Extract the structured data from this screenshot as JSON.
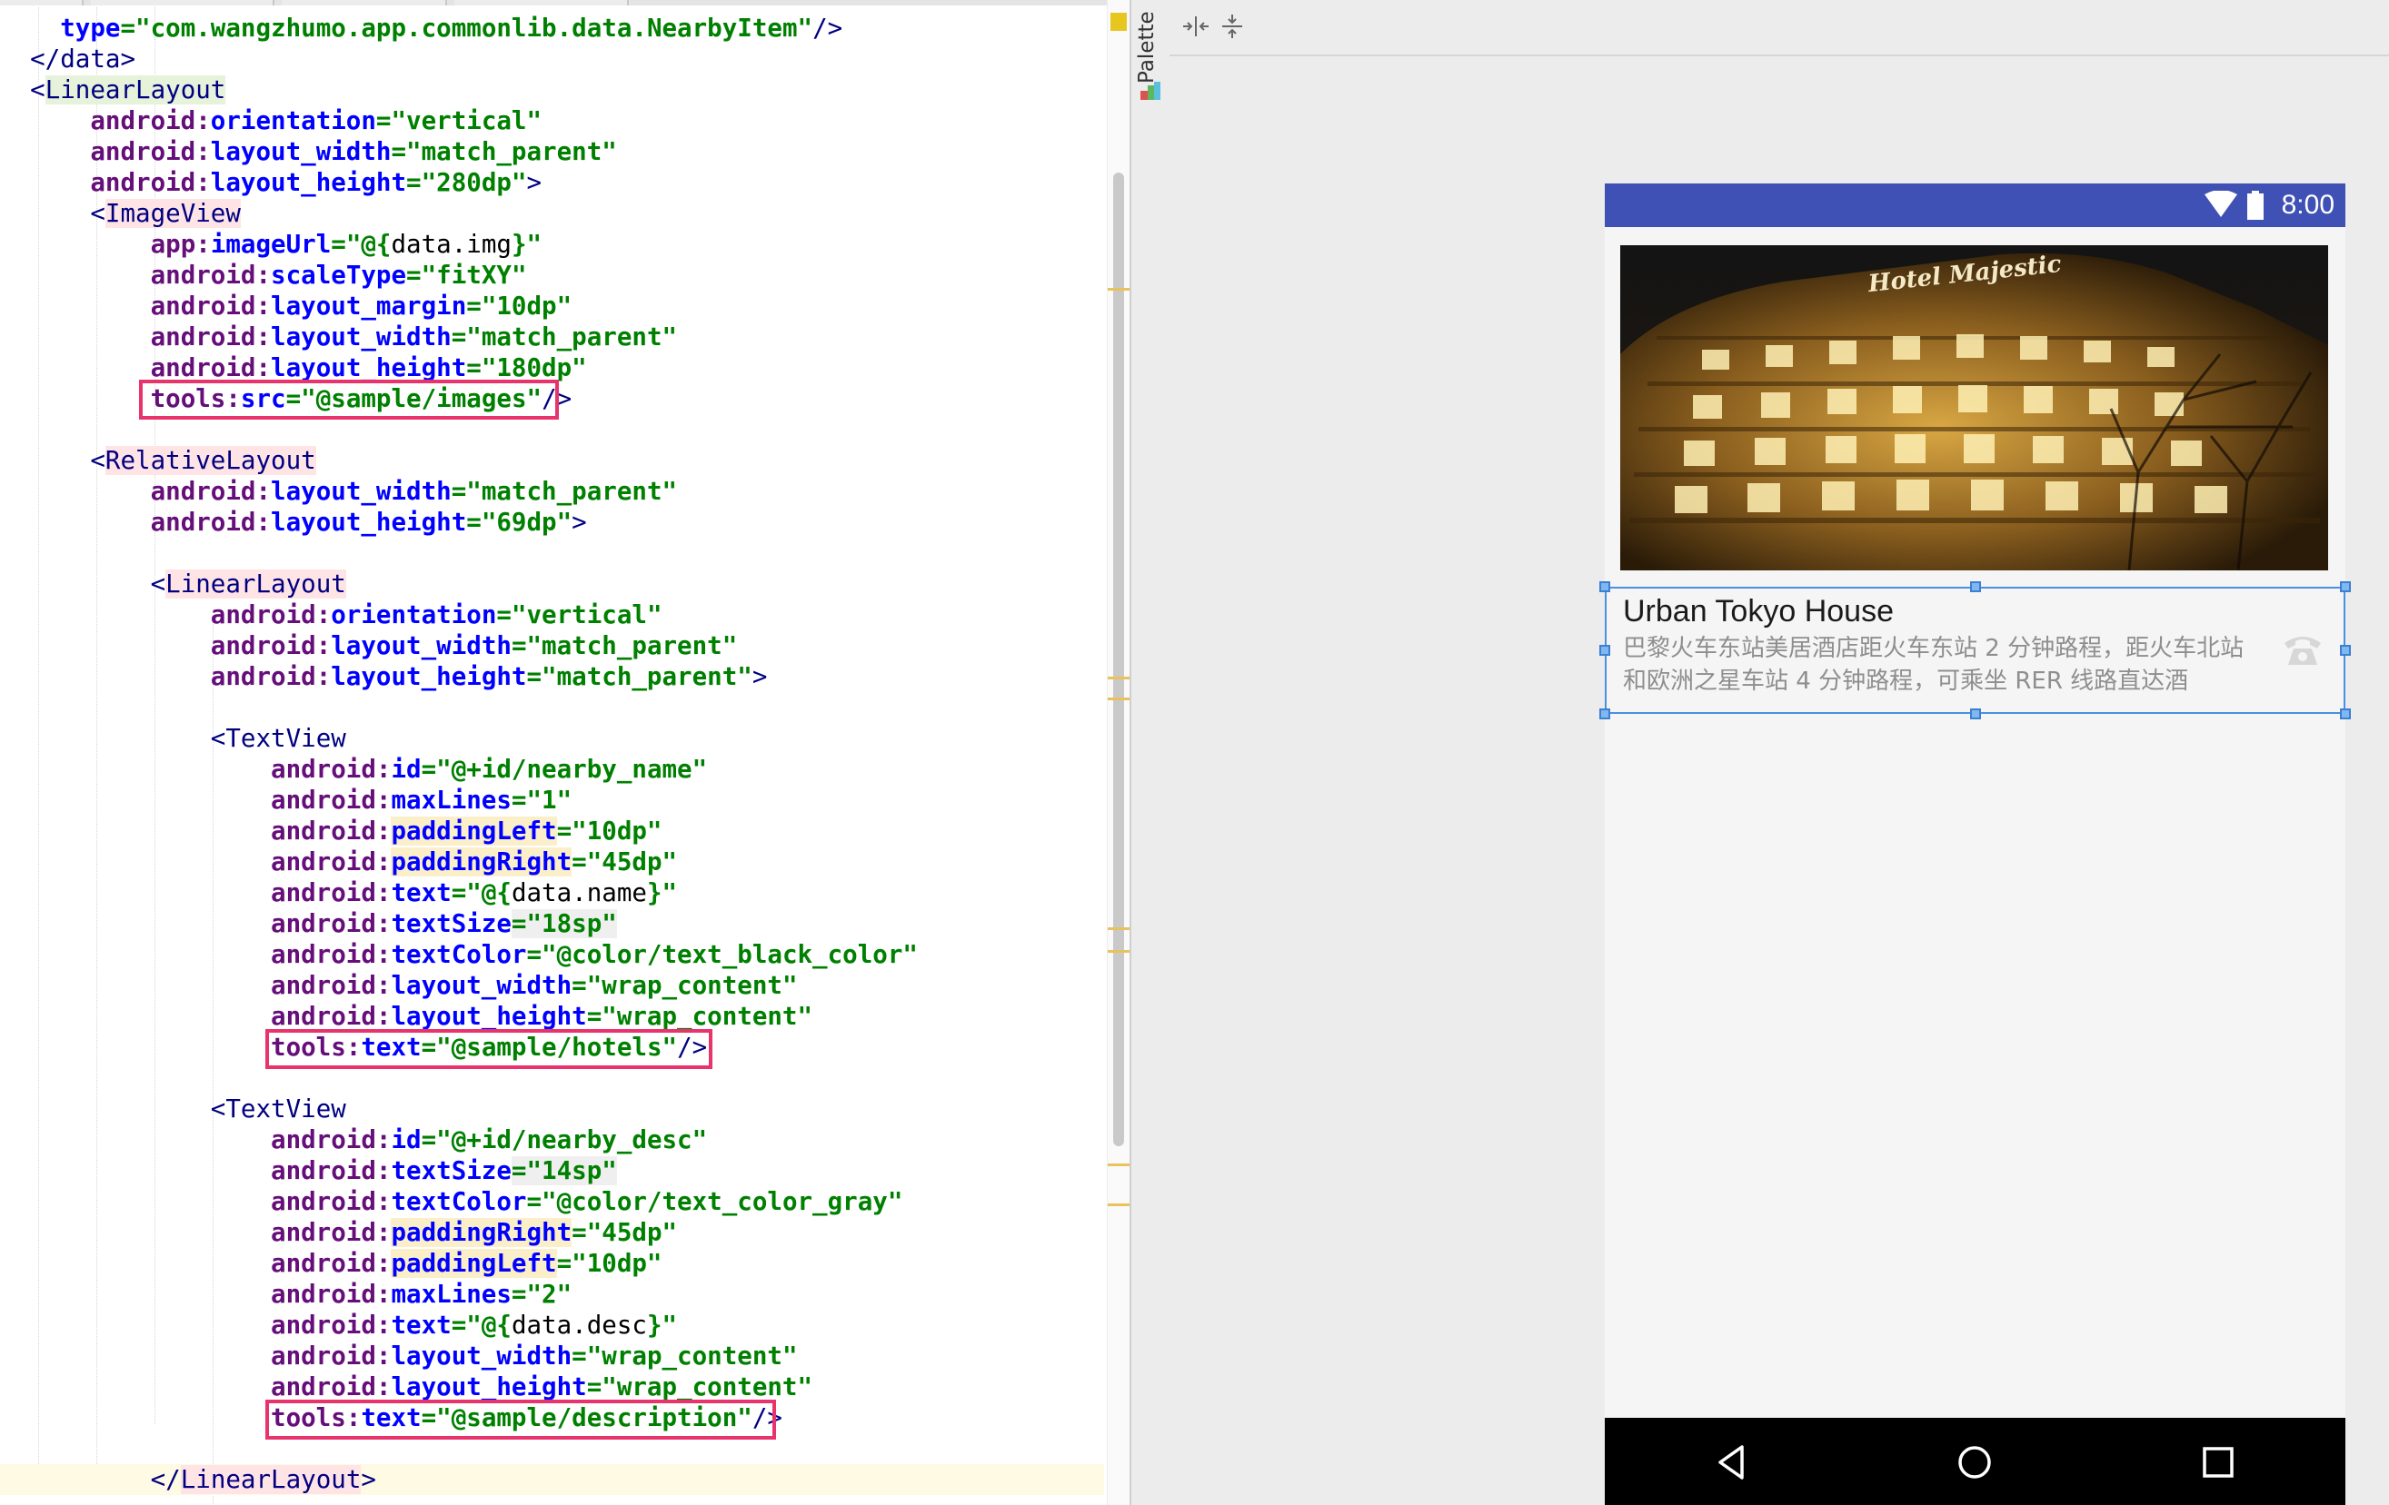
{
  "editor": {
    "lines": [
      [
        [
          "",
          "    "
        ],
        [
          "attr",
          "type"
        ],
        [
          "val",
          "=\"com.wangzhumo.app.commonlib.data.NearbyItem\""
        ],
        [
          "tag",
          "/>"
        ]
      ],
      [
        [
          "",
          "  "
        ],
        [
          "tag",
          "</data>"
        ]
      ],
      [
        [
          "",
          "  "
        ],
        [
          "tag",
          "<"
        ],
        [
          "tagname-sel",
          "LinearLayout"
        ]
      ],
      [
        [
          "",
          "      "
        ],
        [
          "nsp",
          "android:"
        ],
        [
          "attr",
          "orientation"
        ],
        [
          "val",
          "=\"vertical\""
        ]
      ],
      [
        [
          "",
          "      "
        ],
        [
          "nsp",
          "android:"
        ],
        [
          "attr",
          "layout_width"
        ],
        [
          "val",
          "=\"match_parent\""
        ]
      ],
      [
        [
          "",
          "      "
        ],
        [
          "nsp",
          "android:"
        ],
        [
          "attr",
          "layout_height"
        ],
        [
          "val",
          "=\"280dp\""
        ],
        [
          "tag",
          ">"
        ]
      ],
      [
        [
          "",
          "      "
        ],
        [
          "tag",
          "<"
        ],
        [
          "tagname-hl",
          "ImageView"
        ]
      ],
      [
        [
          "",
          "          "
        ],
        [
          "nsp",
          "app:"
        ],
        [
          "attr",
          "imageUrl"
        ],
        [
          "val",
          "=\"@{"
        ],
        [
          "val-plain",
          "data.img"
        ],
        [
          "val",
          "}\""
        ]
      ],
      [
        [
          "",
          "          "
        ],
        [
          "nsp",
          "android:"
        ],
        [
          "attr",
          "scaleType"
        ],
        [
          "val",
          "=\"fitXY\""
        ]
      ],
      [
        [
          "",
          "          "
        ],
        [
          "nsp",
          "android:"
        ],
        [
          "attr",
          "layout_margin"
        ],
        [
          "val",
          "=\"10dp\""
        ]
      ],
      [
        [
          "",
          "          "
        ],
        [
          "nsp",
          "android:"
        ],
        [
          "attr",
          "layout_width"
        ],
        [
          "val",
          "=\"match_parent\""
        ]
      ],
      [
        [
          "",
          "          "
        ],
        [
          "nsp",
          "android:"
        ],
        [
          "attr",
          "layout_height"
        ],
        [
          "val",
          "=\"180dp\""
        ]
      ],
      [
        [
          "",
          "          "
        ],
        [
          "nsp",
          "tools:"
        ],
        [
          "attr",
          "src"
        ],
        [
          "val",
          "=\"@sample/images\""
        ],
        [
          "tag",
          "/>"
        ]
      ],
      [
        [
          "",
          ""
        ]
      ],
      [
        [
          "",
          "      "
        ],
        [
          "tag",
          "<"
        ],
        [
          "tagname-hl",
          "RelativeLayout"
        ]
      ],
      [
        [
          "",
          "          "
        ],
        [
          "nsp",
          "android:"
        ],
        [
          "attr",
          "layout_width"
        ],
        [
          "val",
          "=\"match_parent\""
        ]
      ],
      [
        [
          "",
          "          "
        ],
        [
          "nsp",
          "android:"
        ],
        [
          "attr",
          "layout_height"
        ],
        [
          "val",
          "=\"69dp\""
        ],
        [
          "tag",
          ">"
        ]
      ],
      [
        [
          "",
          ""
        ]
      ],
      [
        [
          "",
          "          "
        ],
        [
          "tag",
          "<"
        ],
        [
          "tagname-hl",
          "LinearLayout"
        ]
      ],
      [
        [
          "",
          "              "
        ],
        [
          "nsp",
          "android:"
        ],
        [
          "attr",
          "orientation"
        ],
        [
          "val",
          "=\"vertical\""
        ]
      ],
      [
        [
          "",
          "              "
        ],
        [
          "nsp",
          "android:"
        ],
        [
          "attr",
          "layout_width"
        ],
        [
          "val",
          "=\"match_parent\""
        ]
      ],
      [
        [
          "",
          "              "
        ],
        [
          "nsp",
          "android:"
        ],
        [
          "attr",
          "layout_height"
        ],
        [
          "val",
          "=\"match_parent\""
        ],
        [
          "tag",
          ">"
        ]
      ],
      [
        [
          "",
          ""
        ]
      ],
      [
        [
          "",
          "              "
        ],
        [
          "tag",
          "<TextView"
        ]
      ],
      [
        [
          "",
          "                  "
        ],
        [
          "nsp",
          "android:"
        ],
        [
          "attr",
          "id"
        ],
        [
          "val",
          "=\"@+id/nearby_name\""
        ]
      ],
      [
        [
          "",
          "                  "
        ],
        [
          "nsp",
          "android:"
        ],
        [
          "attr",
          "maxLines"
        ],
        [
          "val",
          "=\"1\""
        ]
      ],
      [
        [
          "",
          "                  "
        ],
        [
          "nsp",
          "android:"
        ],
        [
          "attr-hl",
          "paddingLeft"
        ],
        [
          "val",
          "=\"10dp\""
        ]
      ],
      [
        [
          "",
          "                  "
        ],
        [
          "nsp",
          "android:"
        ],
        [
          "attr-hl",
          "paddingRight"
        ],
        [
          "val",
          "=\"45dp\""
        ]
      ],
      [
        [
          "",
          "                  "
        ],
        [
          "nsp",
          "android:"
        ],
        [
          "attr",
          "text"
        ],
        [
          "val",
          "=\"@{"
        ],
        [
          "val-plain",
          "data.name"
        ],
        [
          "val",
          "}\""
        ]
      ],
      [
        [
          "",
          "                  "
        ],
        [
          "nsp",
          "android:"
        ],
        [
          "attr",
          "textSize"
        ],
        [
          "val-gray",
          "=\"18sp\""
        ]
      ],
      [
        [
          "",
          "                  "
        ],
        [
          "nsp",
          "android:"
        ],
        [
          "attr",
          "textColor"
        ],
        [
          "val",
          "=\"@color/text_black_color\""
        ]
      ],
      [
        [
          "",
          "                  "
        ],
        [
          "nsp",
          "android:"
        ],
        [
          "attr",
          "layout_width"
        ],
        [
          "val",
          "=\"wrap_content\""
        ]
      ],
      [
        [
          "",
          "                  "
        ],
        [
          "nsp",
          "android:"
        ],
        [
          "attr",
          "layout_height"
        ],
        [
          "val",
          "=\"wrap_content\""
        ]
      ],
      [
        [
          "",
          "                  "
        ],
        [
          "nsp",
          "tools:"
        ],
        [
          "attr",
          "text"
        ],
        [
          "val",
          "=\"@sample/hotels\""
        ],
        [
          "tag",
          "/>"
        ]
      ],
      [
        [
          "",
          ""
        ]
      ],
      [
        [
          "",
          "              "
        ],
        [
          "tag",
          "<TextView"
        ]
      ],
      [
        [
          "",
          "                  "
        ],
        [
          "nsp",
          "android:"
        ],
        [
          "attr",
          "id"
        ],
        [
          "val",
          "=\"@+id/nearby_desc\""
        ]
      ],
      [
        [
          "",
          "                  "
        ],
        [
          "nsp",
          "android:"
        ],
        [
          "attr",
          "textSize"
        ],
        [
          "val-gray",
          "=\"14sp\""
        ]
      ],
      [
        [
          "",
          "                  "
        ],
        [
          "nsp",
          "android:"
        ],
        [
          "attr",
          "textColor"
        ],
        [
          "val",
          "=\"@color/text_color_gray\""
        ]
      ],
      [
        [
          "",
          "                  "
        ],
        [
          "nsp",
          "android:"
        ],
        [
          "attr-hl",
          "paddingRight"
        ],
        [
          "val",
          "=\"45dp\""
        ]
      ],
      [
        [
          "",
          "                  "
        ],
        [
          "nsp",
          "android:"
        ],
        [
          "attr-hl",
          "paddingLeft"
        ],
        [
          "val",
          "=\"10dp\""
        ]
      ],
      [
        [
          "",
          "                  "
        ],
        [
          "nsp",
          "android:"
        ],
        [
          "attr",
          "maxLines"
        ],
        [
          "val",
          "=\"2\""
        ]
      ],
      [
        [
          "",
          "                  "
        ],
        [
          "nsp",
          "android:"
        ],
        [
          "attr",
          "text"
        ],
        [
          "val",
          "=\"@{"
        ],
        [
          "val-plain",
          "data.desc"
        ],
        [
          "val",
          "}\""
        ]
      ],
      [
        [
          "",
          "                  "
        ],
        [
          "nsp",
          "android:"
        ],
        [
          "attr",
          "layout_width"
        ],
        [
          "val",
          "=\"wrap_content\""
        ]
      ],
      [
        [
          "",
          "                  "
        ],
        [
          "nsp",
          "android:"
        ],
        [
          "attr",
          "layout_height"
        ],
        [
          "val",
          "=\"wrap_content\""
        ]
      ],
      [
        [
          "",
          "                  "
        ],
        [
          "nsp",
          "tools:"
        ],
        [
          "attr",
          "text"
        ],
        [
          "val",
          "=\"@sample/description\""
        ],
        [
          "tag",
          "/>"
        ]
      ],
      [
        [
          "",
          ""
        ]
      ],
      [
        [
          "",
          "          "
        ],
        [
          "tag",
          "</"
        ],
        [
          "tagname-hl",
          "LinearLayout"
        ],
        [
          "tag",
          ">"
        ]
      ]
    ]
  },
  "palette": {
    "label": "Palette"
  },
  "toolbar": {
    "icons": [
      "expand-horizontal-icon",
      "expand-vertical-icon"
    ]
  },
  "device": {
    "status_time": "8:00",
    "hotel_sign": "Hotel Majestic",
    "nearby_name": "Urban Tokyo House",
    "nearby_desc": "巴黎火车东站美居酒店距火车东站 2 分钟路程，距火车北站和欧洲之星车站 4 分钟路程，可乘坐 RER 线路直达酒",
    "colors": {
      "status_bar": "#3f51b5",
      "selection": "#4a90e2",
      "nav_bar": "#000000"
    }
  }
}
